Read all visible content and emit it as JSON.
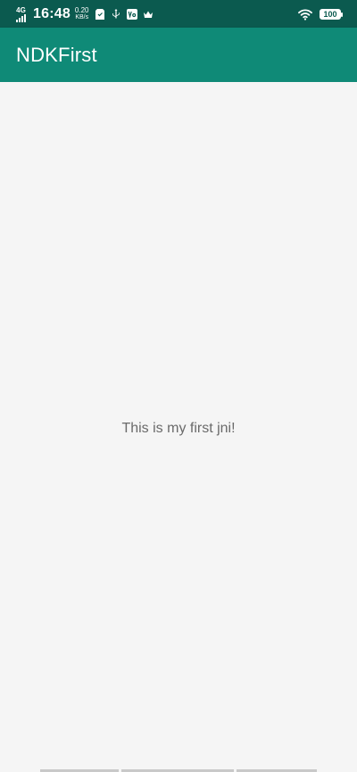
{
  "status_bar": {
    "network_type": "4G",
    "time": "16:48",
    "speed_value": "0.20",
    "speed_unit": "KB/s",
    "battery_level": "100",
    "icons": [
      "signal-icon",
      "sim-card-icon",
      "usb-icon",
      "volte-icon",
      "crown-icon",
      "wifi-icon",
      "battery-icon"
    ]
  },
  "app_bar": {
    "title": "NDKFirst"
  },
  "content": {
    "message": "This is my first jni!"
  },
  "colors": {
    "status_bar_bg": "#0b5a4f",
    "app_bar_bg": "#0f8a77",
    "content_bg": "#f5f5f5",
    "text_secondary": "#6a6a6a"
  }
}
